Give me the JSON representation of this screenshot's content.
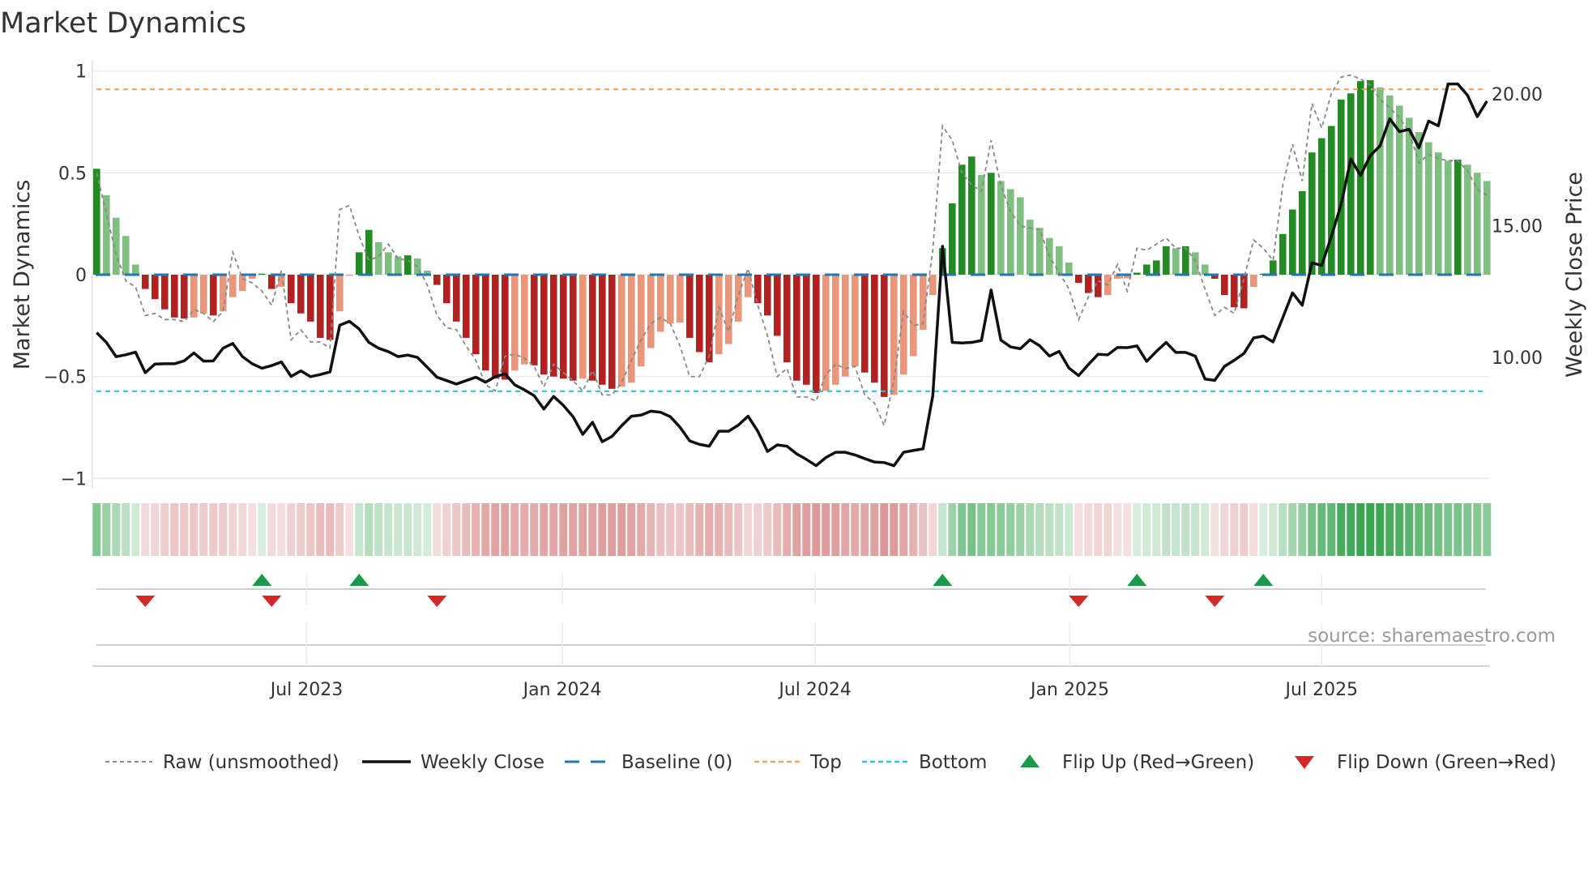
{
  "title": "Market Dynamics",
  "source": "source: sharemaestro.com",
  "colors": {
    "strong_up": "#228b22",
    "weak_up": "#7fbf7f",
    "strong_down": "#b22222",
    "weak_down": "#e9967a",
    "baseline": "#1f77b4",
    "top": "#f4a261",
    "bottom": "#2ec4d0",
    "raw": "#888888",
    "close": "#111111",
    "flip_up": "#1a9b4b",
    "flip_down": "#d62728"
  },
  "legend": {
    "raw": "Raw (unsmoothed)",
    "close": "Weekly Close",
    "baseline": "Baseline (0)",
    "top": "Top",
    "bottom": "Bottom",
    "flip_up": "Flip Up (Red→Green)",
    "flip_down": "Flip Down (Green→Red)"
  },
  "chart_data": {
    "type": "bar",
    "title": "Market Dynamics",
    "ylabel": "Market Dynamics",
    "y2label": "Weekly Close Price",
    "ylim": [
      -1.05,
      1.05
    ],
    "y2lim": [
      5.02,
      21.26
    ],
    "yticks": [
      {
        "v": 1,
        "label": "1"
      },
      {
        "v": 0.5,
        "label": "0.5"
      },
      {
        "v": 0,
        "label": "0"
      },
      {
        "v": -0.5,
        "label": "−0.5"
      },
      {
        "v": -1,
        "label": "−1"
      }
    ],
    "y2ticks": [
      {
        "v": 20,
        "label": "20.00"
      },
      {
        "v": 15,
        "label": "15.00"
      },
      {
        "v": 10,
        "label": "10.00"
      }
    ],
    "x_ticks": [
      {
        "week": 21.6,
        "label": "Jul 2023"
      },
      {
        "week": 47.9,
        "label": "Jan 2024"
      },
      {
        "week": 73.9,
        "label": "Jul 2024"
      },
      {
        "week": 100.1,
        "label": "Jan 2025"
      },
      {
        "week": 126,
        "label": "Jul 2025"
      }
    ],
    "top_threshold": 0.91,
    "bottom_threshold": -0.572,
    "baseline": 0,
    "dynamics": [
      0.52,
      0.39,
      0.28,
      0.19,
      0.05,
      -0.07,
      -0.12,
      -0.17,
      -0.21,
      -0.215,
      -0.21,
      -0.19,
      -0.2,
      -0.18,
      -0.11,
      -0.08,
      -0.02,
      0.005,
      -0.07,
      -0.06,
      -0.14,
      -0.19,
      -0.23,
      -0.31,
      -0.32,
      -0.18,
      -0.005,
      0.11,
      0.22,
      0.16,
      0.11,
      0.09,
      0.095,
      0.08,
      0.02,
      -0.05,
      -0.14,
      -0.23,
      -0.31,
      -0.39,
      -0.47,
      -0.51,
      -0.515,
      -0.47,
      -0.44,
      -0.445,
      -0.49,
      -0.5,
      -0.51,
      -0.52,
      -0.51,
      -0.52,
      -0.54,
      -0.56,
      -0.55,
      -0.53,
      -0.45,
      -0.36,
      -0.28,
      -0.24,
      -0.235,
      -0.31,
      -0.38,
      -0.43,
      -0.39,
      -0.34,
      -0.23,
      -0.11,
      -0.14,
      -0.2,
      -0.3,
      -0.43,
      -0.52,
      -0.54,
      -0.58,
      -0.57,
      -0.54,
      -0.5,
      -0.45,
      -0.48,
      -0.53,
      -0.6,
      -0.59,
      -0.49,
      -0.4,
      -0.27,
      -0.1,
      0.13,
      0.35,
      0.54,
      0.58,
      0.49,
      0.5,
      0.46,
      0.42,
      0.38,
      0.27,
      0.23,
      0.18,
      0.14,
      0.06,
      -0.04,
      -0.09,
      -0.11,
      -0.1,
      -0.02,
      -0.018,
      0.01,
      0.05,
      0.07,
      0.14,
      0.13,
      0.14,
      0.11,
      0.05,
      -0.02,
      -0.1,
      -0.16,
      -0.165,
      -0.06,
      0.005,
      0.07,
      0.2,
      0.32,
      0.41,
      0.6,
      0.67,
      0.73,
      0.86,
      0.89,
      0.95,
      0.955,
      0.92,
      0.88,
      0.83,
      0.77,
      0.7,
      0.65,
      0.6,
      0.56,
      0.565,
      0.54,
      0.5,
      0.46
    ],
    "raw": [
      0.5,
      0.3,
      0.1,
      -0.03,
      -0.06,
      -0.2,
      -0.19,
      -0.22,
      -0.22,
      -0.23,
      -0.17,
      -0.19,
      -0.23,
      -0.18,
      0.11,
      -0.02,
      -0.04,
      -0.08,
      -0.15,
      0.02,
      -0.32,
      -0.27,
      -0.33,
      -0.33,
      -0.36,
      0.32,
      0.34,
      0.19,
      0.07,
      0.09,
      0.15,
      0.08,
      0.07,
      0.04,
      -0.05,
      -0.2,
      -0.26,
      -0.27,
      -0.35,
      -0.42,
      -0.54,
      -0.57,
      -0.4,
      -0.39,
      -0.41,
      -0.45,
      -0.55,
      -0.44,
      -0.48,
      -0.52,
      -0.57,
      -0.47,
      -0.59,
      -0.59,
      -0.53,
      -0.42,
      -0.32,
      -0.24,
      -0.21,
      -0.24,
      -0.35,
      -0.5,
      -0.5,
      -0.4,
      -0.16,
      -0.28,
      -0.1,
      0.03,
      -0.15,
      -0.3,
      -0.5,
      -0.46,
      -0.6,
      -0.6,
      -0.62,
      -0.49,
      -0.44,
      -0.46,
      -0.45,
      -0.59,
      -0.63,
      -0.74,
      -0.52,
      -0.18,
      -0.25,
      -0.24,
      0.12,
      0.73,
      0.66,
      0.5,
      0.44,
      0.41,
      0.66,
      0.44,
      0.31,
      0.24,
      0.23,
      0.22,
      0.09,
      0.01,
      -0.07,
      -0.22,
      -0.11,
      -0.03,
      -0.05,
      0.05,
      -0.08,
      0.13,
      0.12,
      0.15,
      0.18,
      0.13,
      0.13,
      0.07,
      -0.07,
      -0.2,
      -0.16,
      -0.19,
      -0.02,
      0.17,
      0.13,
      0.07,
      0.44,
      0.64,
      0.46,
      0.84,
      0.72,
      0.89,
      0.97,
      0.98,
      0.96,
      0.93,
      0.86,
      0.82,
      0.77,
      0.7,
      0.55,
      0.59,
      0.57,
      0.56,
      0.56,
      0.51,
      0.42,
      0.39
    ],
    "close": [
      10.94,
      10.57,
      10.03,
      10.1,
      10.2,
      9.42,
      9.75,
      9.76,
      9.76,
      9.87,
      10.17,
      9.86,
      9.87,
      10.35,
      10.53,
      10.03,
      9.76,
      9.59,
      9.69,
      9.83,
      9.28,
      9.49,
      9.27,
      9.35,
      9.45,
      11.22,
      11.37,
      11.08,
      10.57,
      10.35,
      10.22,
      10.03,
      10.09,
      10.0,
      9.63,
      9.25,
      9.12,
      8.99,
      9.12,
      9.25,
      9.06,
      9.27,
      9.38,
      8.96,
      8.77,
      8.55,
      8.04,
      8.52,
      8.18,
      7.75,
      7.08,
      7.54,
      6.8,
      7.0,
      7.41,
      7.77,
      7.81,
      7.96,
      7.92,
      7.75,
      7.35,
      6.83,
      6.7,
      6.63,
      7.2,
      7.2,
      7.43,
      7.77,
      7.2,
      6.43,
      6.68,
      6.63,
      6.34,
      6.13,
      5.89,
      6.2,
      6.4,
      6.4,
      6.3,
      6.16,
      6.03,
      6.01,
      5.89,
      6.4,
      6.47,
      6.53,
      8.55,
      14.22,
      10.57,
      10.55,
      10.57,
      10.64,
      12.56,
      10.66,
      10.4,
      10.33,
      10.67,
      10.44,
      10.05,
      10.23,
      9.6,
      9.31,
      9.73,
      10.12,
      10.1,
      10.38,
      10.37,
      10.44,
      9.85,
      10.23,
      10.57,
      10.19,
      10.19,
      10.05,
      9.18,
      9.13,
      9.66,
      9.89,
      10.15,
      10.74,
      10.81,
      10.59,
      11.51,
      12.45,
      11.98,
      13.59,
      13.49,
      14.6,
      15.81,
      17.53,
      16.91,
      17.66,
      18.03,
      19.06,
      18.57,
      18.66,
      17.96,
      18.97,
      18.79,
      20.38,
      20.38,
      19.95,
      19.14,
      19.73
    ],
    "flips_up": [
      17,
      27,
      87,
      107,
      120
    ],
    "flips_down": [
      5,
      18,
      35,
      101,
      115
    ],
    "grid": true,
    "legend_position": "bottom"
  }
}
